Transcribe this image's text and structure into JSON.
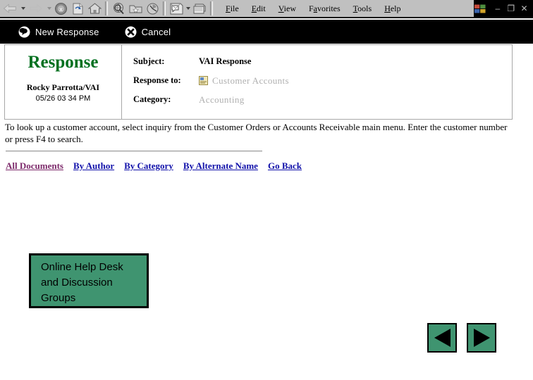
{
  "browser": {
    "toolbar_buttons": [
      {
        "name": "back-button",
        "icon": "arrow-left-icon",
        "enabled": true
      },
      {
        "name": "forward-button",
        "icon": "arrow-right-icon",
        "enabled": false
      },
      {
        "name": "stop-button",
        "icon": "stop-icon",
        "enabled": true
      },
      {
        "name": "refresh-button",
        "icon": "refresh-icon",
        "enabled": true
      },
      {
        "name": "home-button",
        "icon": "home-icon",
        "enabled": true
      },
      {
        "name": "search-button",
        "icon": "search-globe-icon",
        "enabled": true
      },
      {
        "name": "favorites-button",
        "icon": "favorites-folder-icon",
        "enabled": true
      },
      {
        "name": "history-button",
        "icon": "history-clock-icon",
        "enabled": true
      },
      {
        "name": "mail-button",
        "icon": "mail-icon",
        "enabled": true
      },
      {
        "name": "print-button",
        "icon": "printer-icon",
        "enabled": true
      }
    ],
    "menu": [
      {
        "label": "File",
        "accel": "F"
      },
      {
        "label": "Edit",
        "accel": "E"
      },
      {
        "label": "View",
        "accel": "V"
      },
      {
        "label": "Favorites",
        "accel": "a"
      },
      {
        "label": "Tools",
        "accel": "T"
      },
      {
        "label": "Help",
        "accel": "H"
      }
    ],
    "window_controls": {
      "minimize": "–",
      "restore": "❐",
      "close": "✕"
    }
  },
  "action_bar": {
    "new_response_label": "New Response",
    "cancel_label": "Cancel"
  },
  "document": {
    "title": "Response",
    "title_color": "#00701f",
    "author": "Rocky Parrotta/VAI",
    "date": "05/26 03 34 PM",
    "fields": [
      {
        "label": "Subject:",
        "value": "VAI Response",
        "muted": false,
        "icon": null
      },
      {
        "label": "Response to:",
        "value": "Customer Accounts",
        "muted": true,
        "icon": "document-icon"
      },
      {
        "label": "Category:",
        "value": "Accounting",
        "muted": true,
        "icon": null
      }
    ],
    "body": "To look up a customer account, select inquiry from the Customer Orders or Accounts Receivable main menu. Enter the customer number or press F4 to search."
  },
  "nav_links": [
    {
      "label": "All Documents",
      "state": "visited"
    },
    {
      "label": "By Author",
      "state": "unvisited"
    },
    {
      "label": "By Category",
      "state": "unvisited"
    },
    {
      "label": "By Alternate Name",
      "state": "unvisited"
    },
    {
      "label": "Go Back",
      "state": "unvisited"
    }
  ],
  "helpdesk_banner": {
    "text": "Online Help Desk and Discussion Groups",
    "background": "#3f9470",
    "border": "#000000"
  },
  "pager": {
    "previous_label": "Previous",
    "next_label": "Next",
    "background": "#3f9470"
  }
}
